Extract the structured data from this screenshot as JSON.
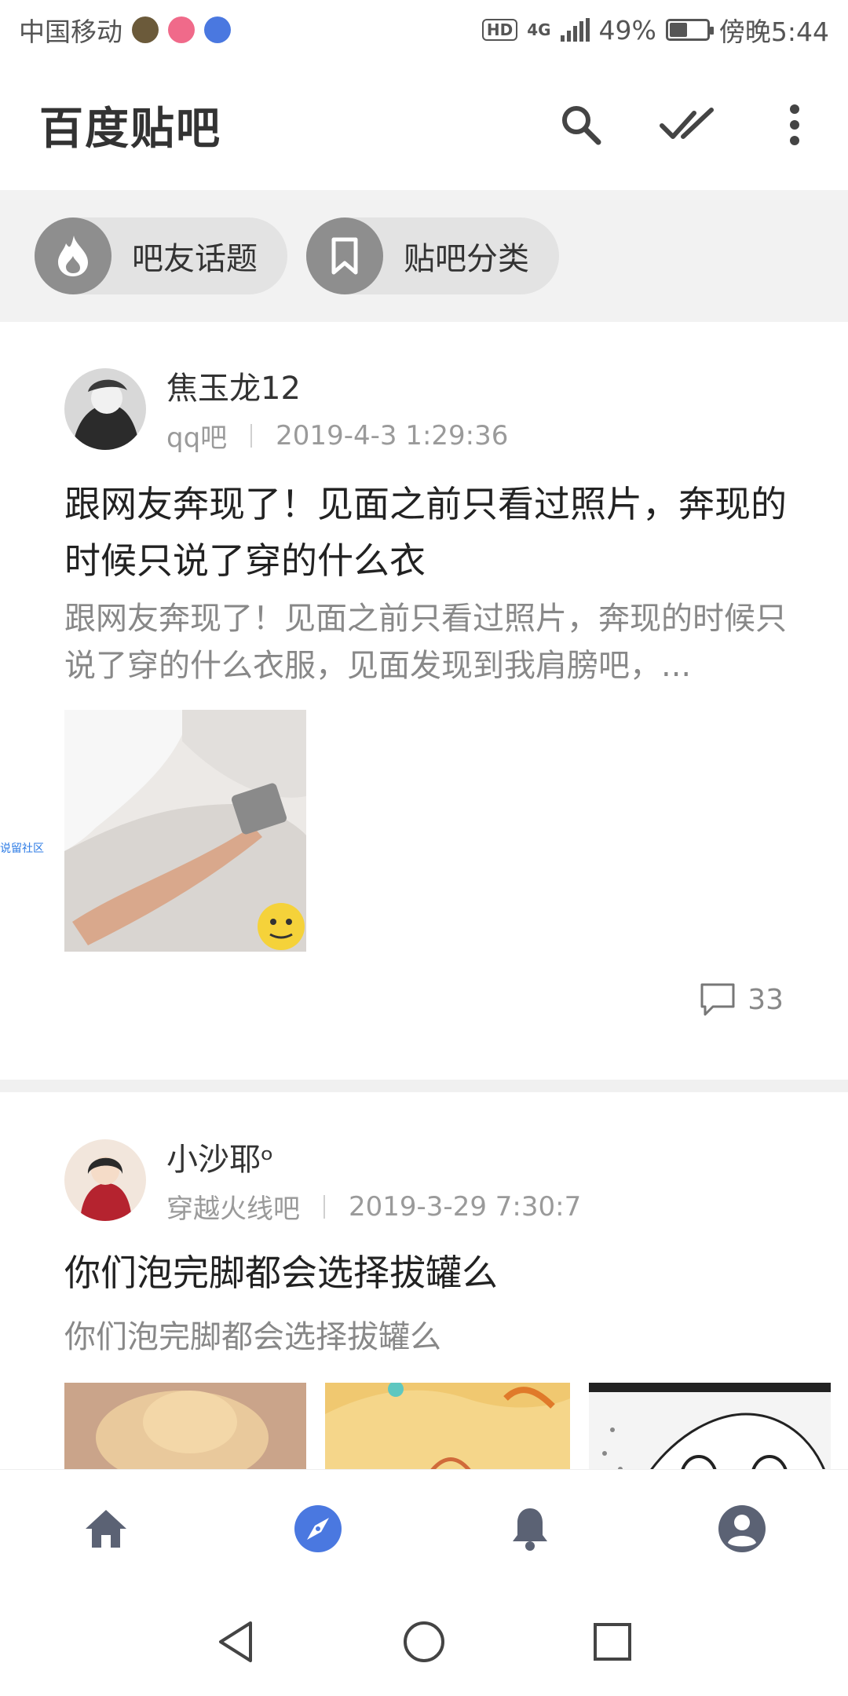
{
  "status_bar": {
    "carrier": "中国移动",
    "network": "4G",
    "hd": "HD",
    "battery_percent": "49%",
    "battery_level": 0.49,
    "time": "傍晚5:44"
  },
  "app_bar": {
    "title": "百度贴吧",
    "icons": [
      "search-icon",
      "mark-read-icon",
      "more-vert-icon"
    ]
  },
  "chips": [
    {
      "label": "吧友话题",
      "icon": "flame-icon"
    },
    {
      "label": "贴吧分类",
      "icon": "bookmark-icon"
    }
  ],
  "posts": [
    {
      "author": "焦玉龙12",
      "forum": "qq吧",
      "time": "2019-4-3 1:29:36",
      "title": "跟网友奔现了！见面之前只看过照片，奔现的时候只说了穿的什么衣",
      "excerpt": "跟网友奔现了！见面之前只看过照片，奔现的时候只说了穿的什么衣服，见面发现到我肩膀吧，...",
      "comments": "33"
    },
    {
      "author": "小沙耶ᵒ",
      "forum": "穿越火线吧",
      "time": "2019-3-29 7:30:7",
      "title": "你们泡完脚都会选择拔罐么",
      "excerpt": "你们泡完脚都会选择拔罐么"
    }
  ],
  "side_tag": "说留社区",
  "bottom_nav": [
    "home-icon",
    "discover-compass-icon",
    "notification-bell-icon",
    "profile-icon"
  ],
  "colors": {
    "accent": "#4a78e0",
    "nav_icon": "#5b6274",
    "chip_bg": "#e3e3e3",
    "chip_icon_bg": "#8e8e8e"
  }
}
